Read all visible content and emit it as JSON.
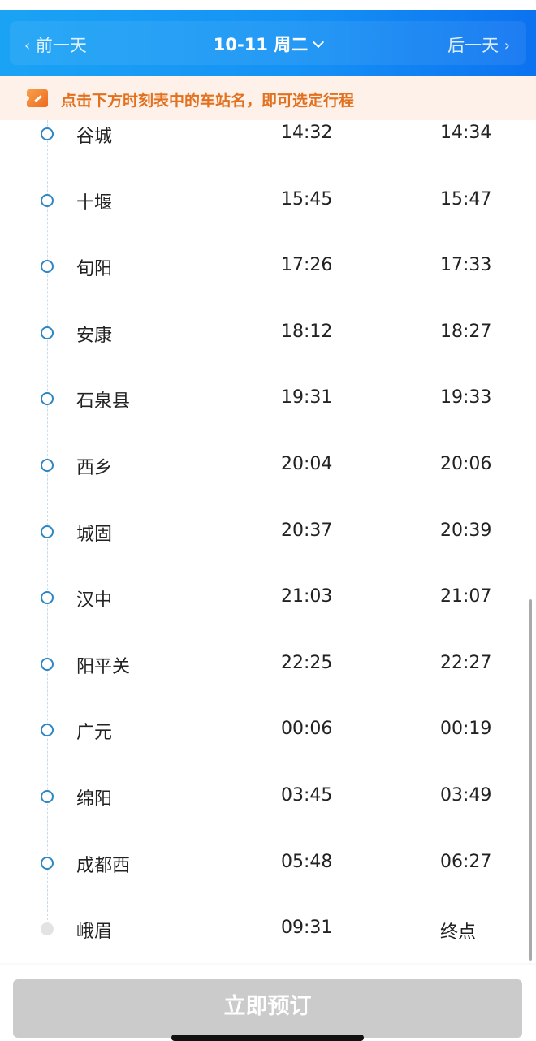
{
  "header": {
    "prev_day": "前一天",
    "next_day": "后一天",
    "date": "10-11 周二",
    "accent_color": "#1592f5"
  },
  "notice": {
    "icon": "ticket-icon",
    "text": "点击下方时刻表中的车站名，即可选定行程",
    "color": "#e2711f"
  },
  "stations": [
    {
      "name": "谷城",
      "arrive": "14:32",
      "depart": "14:34"
    },
    {
      "name": "十堰",
      "arrive": "15:45",
      "depart": "15:47"
    },
    {
      "name": "旬阳",
      "arrive": "17:26",
      "depart": "17:33"
    },
    {
      "name": "安康",
      "arrive": "18:12",
      "depart": "18:27"
    },
    {
      "name": "石泉县",
      "arrive": "19:31",
      "depart": "19:33"
    },
    {
      "name": "西乡",
      "arrive": "20:04",
      "depart": "20:06"
    },
    {
      "name": "城固",
      "arrive": "20:37",
      "depart": "20:39"
    },
    {
      "name": "汉中",
      "arrive": "21:03",
      "depart": "21:07"
    },
    {
      "name": "阳平关",
      "arrive": "22:25",
      "depart": "22:27"
    },
    {
      "name": "广元",
      "arrive": "00:06",
      "depart": "00:19"
    },
    {
      "name": "绵阳",
      "arrive": "03:45",
      "depart": "03:49"
    },
    {
      "name": "成都西",
      "arrive": "05:48",
      "depart": "06:27"
    },
    {
      "name": "峨眉",
      "arrive": "09:31",
      "depart": "终点"
    }
  ],
  "footer": {
    "book_label": "立即预订"
  }
}
